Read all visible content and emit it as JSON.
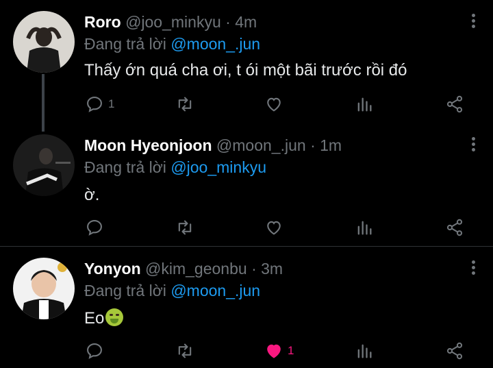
{
  "tweets": [
    {
      "name": "Roro",
      "handle": "@joo_minkyu",
      "separator": "·",
      "time": "4m",
      "reply_prefix": "Đang trả lời",
      "reply_to": "@moon_.jun",
      "text": "Thấy ớn quá cha ơi, t ói một bãi trước rồi đó",
      "reply_count": "1",
      "like_count": ""
    },
    {
      "name": "Moon Hyeonjoon",
      "handle": "@moon_.jun",
      "separator": "·",
      "time": "1m",
      "reply_prefix": "Đang trả lời",
      "reply_to": "@joo_minkyu",
      "text": "ờ.",
      "reply_count": "",
      "like_count": ""
    },
    {
      "name": "Yonyon",
      "handle": "@kim_geonbu",
      "separator": "·",
      "time": "3m",
      "reply_prefix": "Đang trả lời",
      "reply_to": "@moon_.jun",
      "text": "Eo",
      "emoji": "nauseated-face",
      "reply_count": "",
      "like_count": "1"
    }
  ],
  "colors": {
    "background": "#000000",
    "text": "#e7e9ea",
    "secondary": "#71767b",
    "mention": "#1d9bf0",
    "like": "#f91880"
  },
  "icons": [
    "reply-icon",
    "retweet-icon",
    "like-icon",
    "views-icon",
    "share-icon",
    "more-icon"
  ]
}
